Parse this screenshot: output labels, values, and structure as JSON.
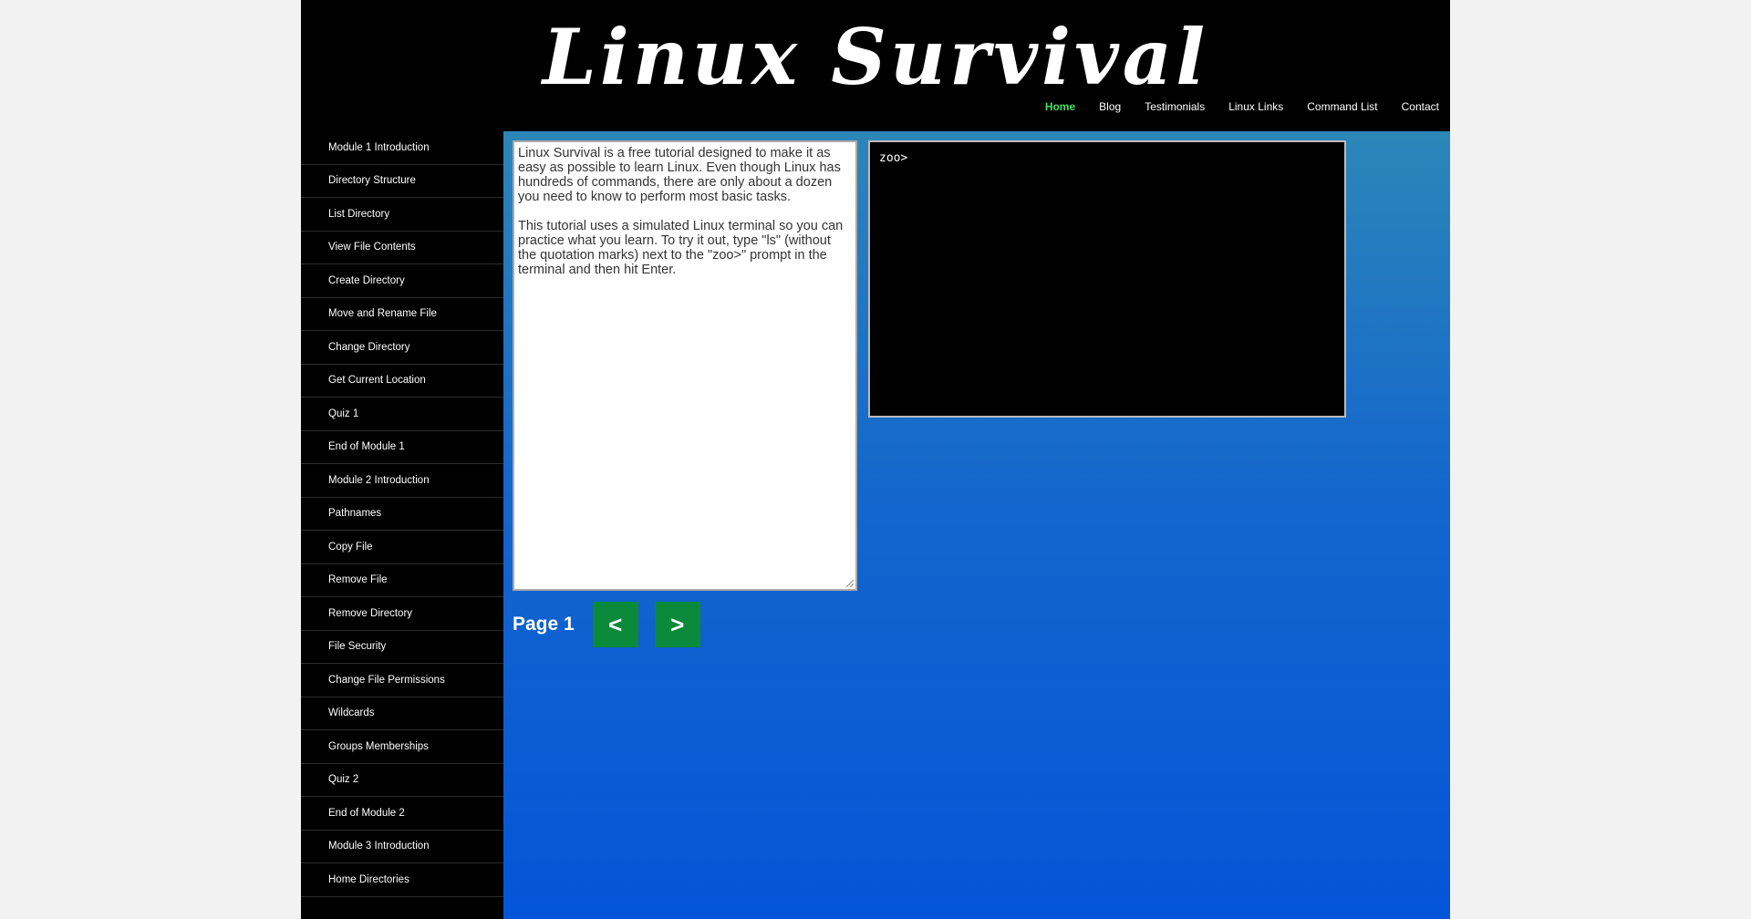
{
  "header": {
    "title": "Linux Survival",
    "nav": [
      {
        "label": "Home",
        "active": true
      },
      {
        "label": "Blog"
      },
      {
        "label": "Testimonials"
      },
      {
        "label": "Linux Links"
      },
      {
        "label": "Command List"
      },
      {
        "label": "Contact"
      }
    ]
  },
  "sidebar": {
    "items": [
      {
        "label": "Module 1 Introduction"
      },
      {
        "label": "Directory Structure"
      },
      {
        "label": "List Directory"
      },
      {
        "label": "View File Contents"
      },
      {
        "label": "Create Directory"
      },
      {
        "label": "Move and Rename File"
      },
      {
        "label": "Change Directory"
      },
      {
        "label": "Get Current Location"
      },
      {
        "label": "Quiz 1"
      },
      {
        "label": "End of Module 1"
      },
      {
        "label": "Module 2 Introduction"
      },
      {
        "label": "Pathnames"
      },
      {
        "label": "Copy File"
      },
      {
        "label": "Remove File"
      },
      {
        "label": "Remove Directory"
      },
      {
        "label": "File Security"
      },
      {
        "label": "Change File Permissions"
      },
      {
        "label": "Wildcards"
      },
      {
        "label": "Groups Memberships"
      },
      {
        "label": "Quiz 2"
      },
      {
        "label": "End of Module 2"
      },
      {
        "label": "Module 3 Introduction"
      },
      {
        "label": "Home Directories"
      }
    ]
  },
  "tutorial": {
    "paragraphs": [
      "Linux Survival is a free tutorial designed to make it as easy as possible to learn Linux. Even though Linux has hundreds of commands, there are only about a dozen you need to know to perform most basic tasks.",
      "This tutorial uses a simulated Linux terminal so you can practice what you learn. To try it out, type \"ls\" (without the quotation marks) next to the \"zoo>\" prompt in the terminal and then hit Enter."
    ]
  },
  "terminal": {
    "prompt": "zoo>"
  },
  "pager": {
    "label": "Page 1",
    "prev_label": "<",
    "next_label": ">"
  },
  "icons": {
    "resize": "resize-grip-icon"
  }
}
